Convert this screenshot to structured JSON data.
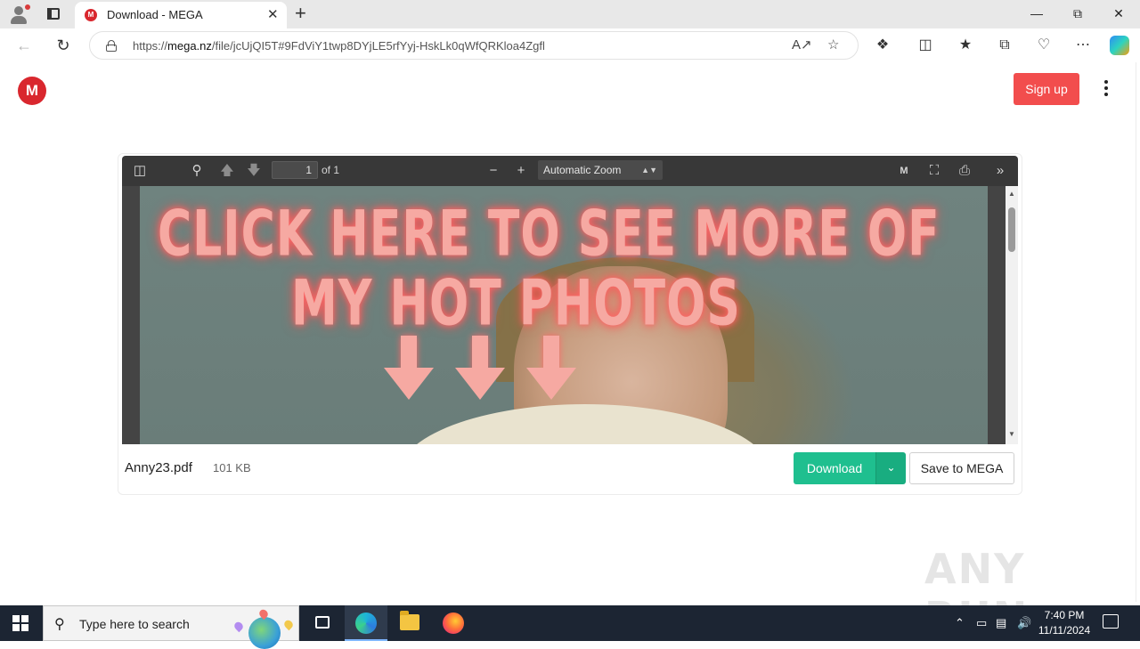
{
  "browser": {
    "tab_title": "Download - MEGA",
    "tab_favicon": "M",
    "url_prefix": "https://",
    "url_domain": "mega.nz",
    "url_path": "/file/jcUjQI5T#9FdViY1twp8DYjLE5rfYyj-HskLk0qWfQRKloa4Zgfl",
    "newtab_glyph": "+",
    "close_glyph": "✕"
  },
  "page": {
    "logo": "M",
    "signup_label": "Sign up"
  },
  "pdf_viewer": {
    "page_number": "1",
    "page_count_label": "of 1",
    "zoom_label": "Automatic Zoom",
    "promo_line1": "CLICK HERE TO SEE MORE OF",
    "promo_line2": "MY HOT PHOTOS"
  },
  "file": {
    "name": "Anny23.pdf",
    "size": "101 KB",
    "download_label": "Download",
    "save_label": "Save to MEGA"
  },
  "watermark": "ANY RUN",
  "taskbar": {
    "search_placeholder": "Type here to search",
    "time": "7:40 PM",
    "date": "11/11/2024"
  },
  "colors": {
    "mega_red": "#d9272e",
    "signup_red": "#f24d4d",
    "download_green": "#1fbf8f",
    "taskbar_bg": "#1c2533"
  }
}
